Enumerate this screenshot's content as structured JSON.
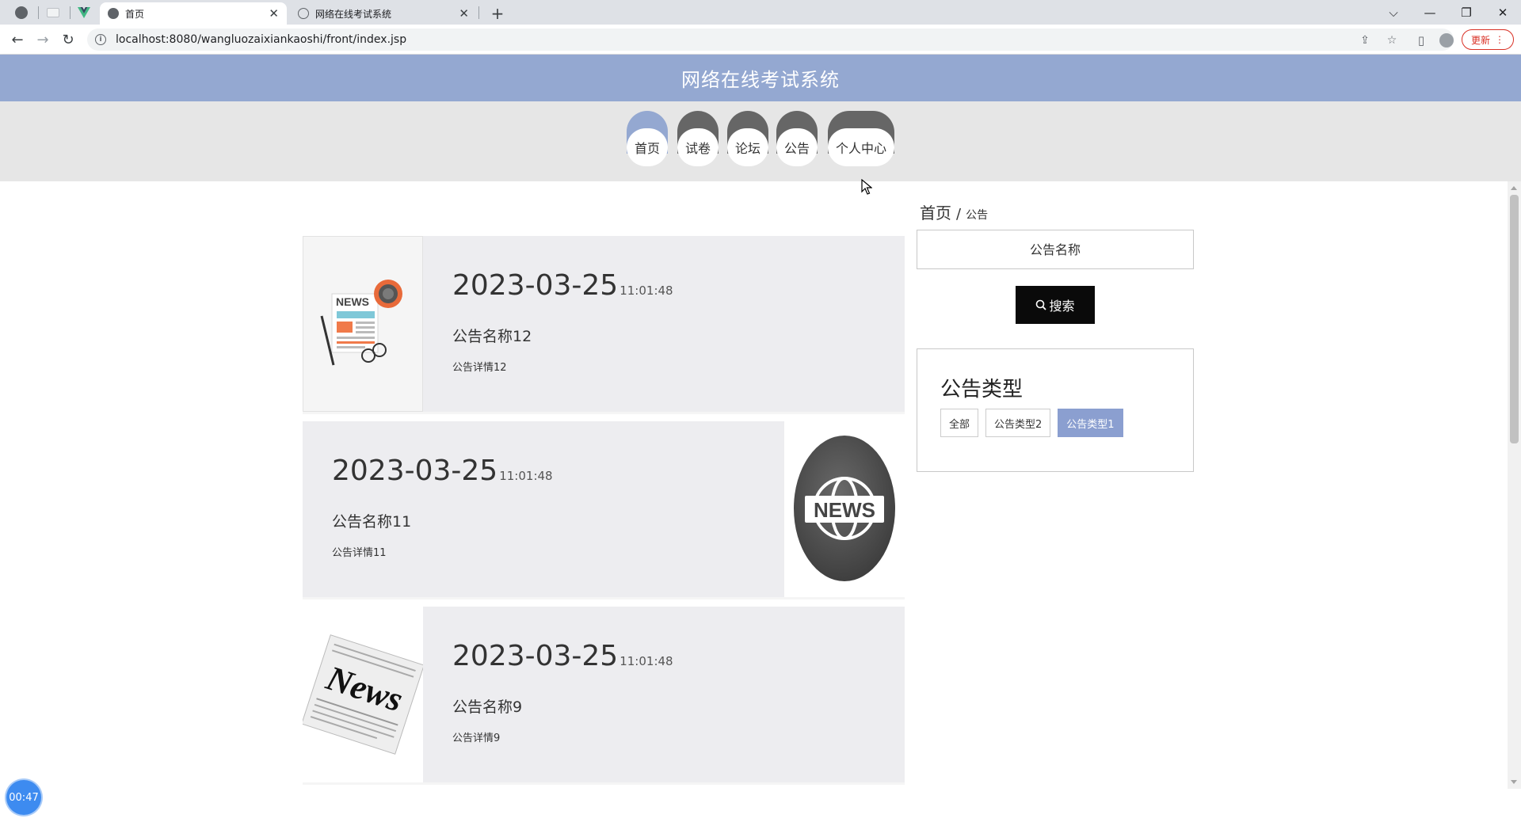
{
  "browser": {
    "tabs": [
      {
        "title": "首页",
        "active": true
      },
      {
        "title": "网络在线考试系统",
        "active": false
      }
    ],
    "url": "localhost:8080/wangluozaixiankaoshi/front/index.jsp",
    "update_label": "更新"
  },
  "site": {
    "title": "网络在线考试系统"
  },
  "nav": {
    "items": [
      {
        "label": "首页",
        "active": true
      },
      {
        "label": "试卷",
        "active": false
      },
      {
        "label": "论坛",
        "active": false
      },
      {
        "label": "公告",
        "active": false
      },
      {
        "label": "个人中心",
        "active": false
      }
    ]
  },
  "notices": [
    {
      "date": "2023-03-25",
      "time": "11:01:48",
      "name": "公告名称12",
      "detail": "公告详情12",
      "image": "news-paper-icon"
    },
    {
      "date": "2023-03-25",
      "time": "11:01:48",
      "name": "公告名称11",
      "detail": "公告详情11",
      "image": "news-globe-icon"
    },
    {
      "date": "2023-03-25",
      "time": "11:01:48",
      "name": "公告名称9",
      "detail": "公告详情9",
      "image": "newspaper-icon"
    }
  ],
  "sidebar": {
    "breadcrumb_home": "首页",
    "breadcrumb_sep": "/",
    "breadcrumb_current": "公告",
    "search_placeholder": "公告名称",
    "search_label": "搜索",
    "types_title": "公告类型",
    "types": [
      {
        "label": "全部",
        "active": false
      },
      {
        "label": "公告类型2",
        "active": false
      },
      {
        "label": "公告类型1",
        "active": true
      }
    ]
  },
  "timer": "00:47",
  "colors": {
    "accent": "#94a8d1",
    "nav_inactive": "#666666",
    "chip_active": "#8b9fd0",
    "search_button": "#0a0a0a"
  }
}
